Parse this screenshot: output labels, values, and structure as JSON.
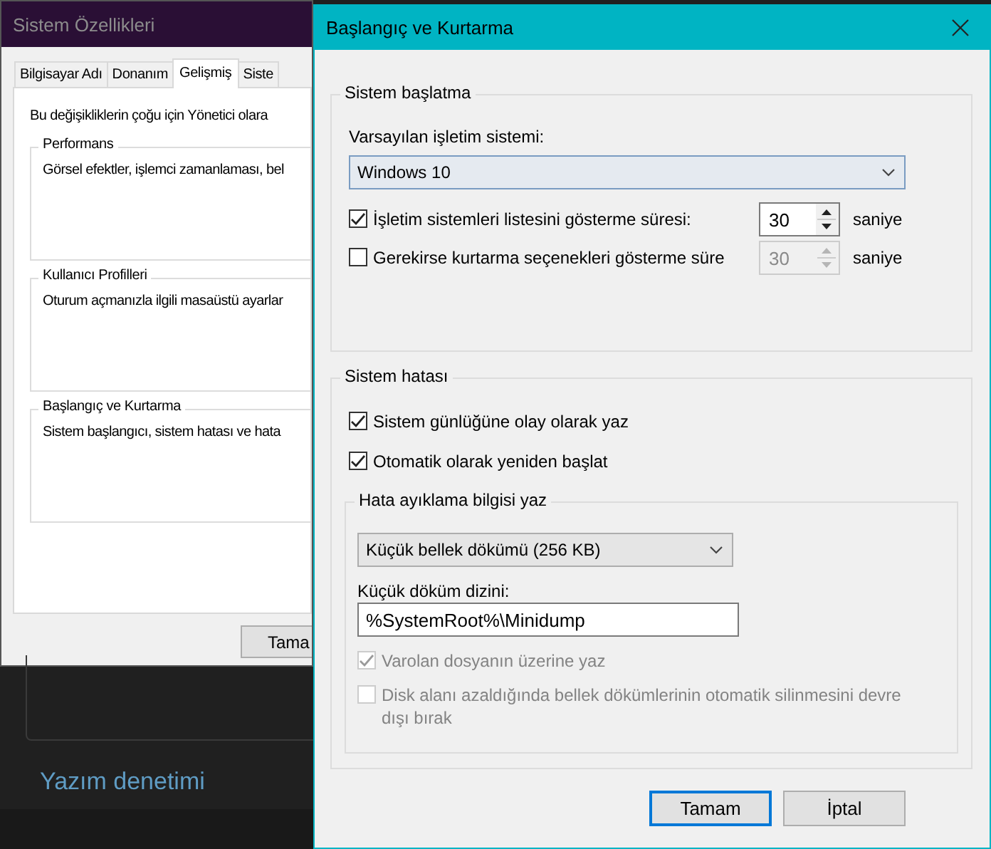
{
  "background_window": {
    "title": "Sistem Özellikleri",
    "tabs": [
      {
        "label": "Bilgisayar Adı",
        "selected": false
      },
      {
        "label": "Donanım",
        "selected": false
      },
      {
        "label": "Gelişmiş",
        "selected": true
      },
      {
        "label": "Siste",
        "selected": false
      }
    ],
    "intro": "Bu değişikliklerin çoğu için Yönetici olara",
    "groups": [
      {
        "title": "Performans",
        "text": "Görsel efektler, işlemci zamanlaması, bel"
      },
      {
        "title": "Kullanıcı Profilleri",
        "text": "Oturum açmanızla ilgili masaüstü ayarlar"
      },
      {
        "title": "Başlangıç ve Kurtarma",
        "text": "Sistem başlangıcı, sistem hatası ve hata"
      }
    ],
    "buttons": [
      "Tama"
    ]
  },
  "desktop": {
    "heading": "Yazım denetimi"
  },
  "dialog": {
    "title": "Başlangıç ve Kurtarma",
    "startup": {
      "title": "Sistem başlatma",
      "default_os_label": "Varsayılan işletim sistemi:",
      "default_os": "Windows 10",
      "options": [
        {
          "label": "İşletim sistemleri listesini gösterme süresi:",
          "checked": true,
          "value": "30",
          "unit": "saniye"
        },
        {
          "label": "Gerekirse kurtarma seçenekleri gösterme süre",
          "checked": false,
          "value": "30",
          "unit": "saniye"
        }
      ]
    },
    "failure": {
      "title": "Sistem hatası",
      "options": [
        {
          "label": "Sistem günlüğüne olay olarak yaz",
          "checked": true,
          "disabled": false
        },
        {
          "label": "Otomatik olarak yeniden başlat",
          "checked": true,
          "disabled": false
        }
      ],
      "debug": {
        "title": "Hata ayıklama bilgisi yaz",
        "dump_type": "Küçük bellek dökümü (256 KB)",
        "dir_label": "Küçük döküm dizini:",
        "dir_value": "%SystemRoot%\\Minidump",
        "options": [
          {
            "label": "Varolan dosyanın üzerine yaz",
            "checked": true,
            "disabled": true
          },
          {
            "label": "Disk alanı azaldığında bellek dökümlerinin otomatik silinmesini devre dışı bırak",
            "checked": false,
            "disabled": true
          }
        ]
      }
    },
    "buttons": [
      {
        "label": "Tamam",
        "default": true
      },
      {
        "label": "İptal",
        "default": false
      }
    ]
  }
}
